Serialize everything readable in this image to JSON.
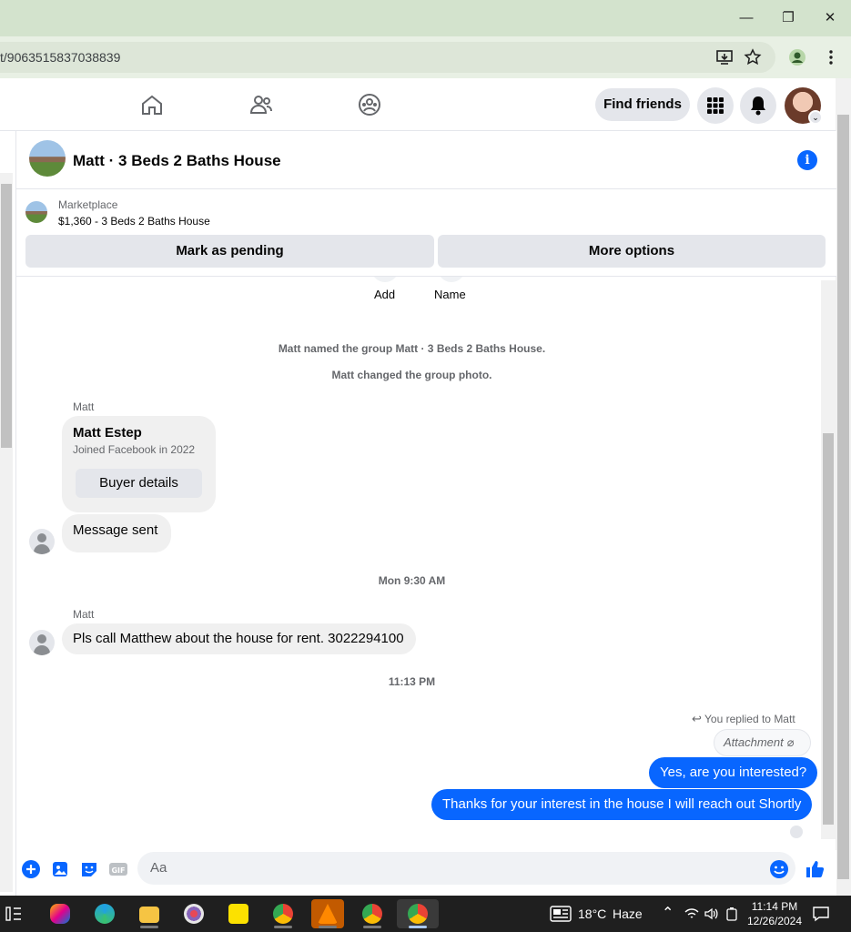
{
  "browser": {
    "url": "t/9063515837038839",
    "minimize": "—",
    "restore": "❐",
    "close": "✕"
  },
  "fb": {
    "find_friends": "Find friends"
  },
  "chat": {
    "title": "Matt · 3 Beds 2 Baths House",
    "marketplace_label": "Marketplace",
    "listing": "$1,360 - 3 Beds 2 Baths House",
    "mark_pending": "Mark as pending",
    "more_options": "More options",
    "add_label": "Add",
    "name_label": "Name",
    "sys1": "Matt named the group Matt · 3 Beds 2 Baths House.",
    "sys2": "Matt changed the group photo.",
    "sender1": "Matt",
    "card_name": "Matt Estep",
    "card_sub": "Joined Facebook in 2022",
    "card_btn": "Buyer details",
    "msg_sent": "Message sent",
    "time1": "Mon 9:30 AM",
    "sender2": "Matt",
    "msg2": "Pls call Matthew about the house for rent.  3022294100",
    "time2": "11:13 PM",
    "replied": "You replied to Matt",
    "attachment": "Attachment",
    "my1": "Yes, are you interested?",
    "my2": "Thanks for your interest in the house I will reach out Shortly",
    "input_placeholder": "Aa"
  },
  "taskbar": {
    "temp": "18°C",
    "weather": "Haze",
    "time": "11:14 PM",
    "date": "12/26/2024"
  },
  "colors": {
    "accent": "#0866ff",
    "chrome_title": "#d3e3cd"
  }
}
